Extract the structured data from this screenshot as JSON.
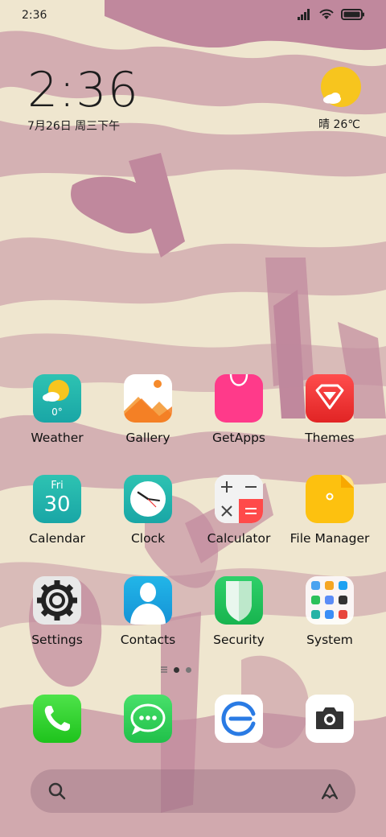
{
  "status": {
    "time": "2:36"
  },
  "clock_widget": {
    "time": "2:36",
    "date": "7月26日 周三下午"
  },
  "weather_widget": {
    "condition": "晴 26℃",
    "icon": "sunny-cloud-icon"
  },
  "apps": [
    {
      "label": "Weather",
      "icon": "weather-icon",
      "temp": "0°"
    },
    {
      "label": "Gallery",
      "icon": "gallery-icon"
    },
    {
      "label": "GetApps",
      "icon": "getapps-icon"
    },
    {
      "label": "Themes",
      "icon": "themes-icon"
    },
    {
      "label": "Calendar",
      "icon": "calendar-icon",
      "day": "Fri",
      "date": "30"
    },
    {
      "label": "Clock",
      "icon": "clock-icon"
    },
    {
      "label": "Calculator",
      "icon": "calculator-icon"
    },
    {
      "label": "File Manager",
      "icon": "file-manager-icon"
    },
    {
      "label": "Settings",
      "icon": "settings-icon"
    },
    {
      "label": "Contacts",
      "icon": "contacts-icon"
    },
    {
      "label": "Security",
      "icon": "security-icon"
    },
    {
      "label": "System",
      "icon": "system-folder-icon"
    }
  ],
  "dock": [
    {
      "icon": "phone-icon"
    },
    {
      "icon": "messaging-icon"
    },
    {
      "icon": "browser-icon"
    },
    {
      "icon": "camera-icon"
    }
  ],
  "colors": {
    "wallpaper_base": "#efe6cf",
    "wallpaper_paint": "#a2577e"
  }
}
